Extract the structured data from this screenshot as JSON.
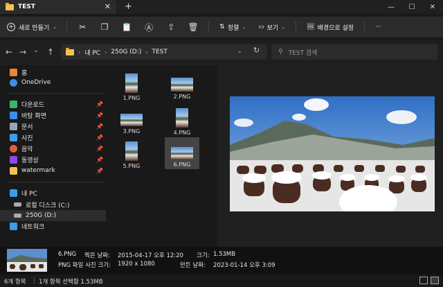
{
  "window": {
    "tab_title": "TEST",
    "tab_close": "✕",
    "new_tab": "+",
    "minimize": "—",
    "maximize": "☐",
    "close": "✕"
  },
  "toolbar": {
    "new_label": "새로 만들기",
    "sort_label": "정렬",
    "view_label": "보기",
    "background_label": "배경으로 설정",
    "more": "···"
  },
  "address": {
    "path": [
      "내 PC",
      "250G (D:)",
      "TEST"
    ],
    "search_placeholder": "TEST 검색"
  },
  "sidebar": {
    "items": [
      {
        "label": "홈",
        "icon": "home-icon",
        "color": "#e8863a"
      },
      {
        "label": "OneDrive",
        "icon": "onedrive-icon",
        "color": "#3a8ee8"
      },
      {
        "label": "다운로드",
        "icon": "download-icon",
        "color": "#3ab56a",
        "pinned": true
      },
      {
        "label": "바탕 화면",
        "icon": "desktop-icon",
        "color": "#3a8ee8",
        "pinned": true
      },
      {
        "label": "문서",
        "icon": "documents-icon",
        "color": "#9aa4b8",
        "pinned": true
      },
      {
        "label": "사진",
        "icon": "pictures-icon",
        "color": "#3aa0e8",
        "pinned": true
      },
      {
        "label": "음악",
        "icon": "music-icon",
        "color": "#e8583a",
        "pinned": true
      },
      {
        "label": "동영상",
        "icon": "videos-icon",
        "color": "#8a4ae8",
        "pinned": true
      },
      {
        "label": "watermark",
        "icon": "folder-icon",
        "color": "#f2c14e",
        "pinned": true
      },
      {
        "label": "내 PC",
        "icon": "this-pc-icon",
        "color": "#3a9ee8"
      },
      {
        "label": "로컬 디스크 (C:)",
        "icon": "drive-icon",
        "color": "#aaaaaa"
      },
      {
        "label": "250G (D:)",
        "icon": "drive-icon",
        "color": "#aaaaaa"
      },
      {
        "label": "네트워크",
        "icon": "network-icon",
        "color": "#3a9ee8"
      }
    ],
    "pin_glyph": "📌"
  },
  "files": [
    {
      "name": "1.PNG"
    },
    {
      "name": "2.PNG"
    },
    {
      "name": "3.PNG"
    },
    {
      "name": "4.PNG"
    },
    {
      "name": "5.PNG"
    },
    {
      "name": "6.PNG"
    }
  ],
  "details": {
    "name": "6.PNG",
    "type": "PNG 파일 사진 크기:",
    "dimensions": "1920 x 1080",
    "taken_label": "찍은 날짜:",
    "taken_value": "2015-04-17 오후 12:20",
    "size_label": "크기:",
    "size_value": "1.53MB",
    "created_label": "만든 날짜:",
    "created_value": "2023-01-14 오후 3:09"
  },
  "status": {
    "count": "6개 항목",
    "selection": "1개 항목 선택함 1.53MB"
  }
}
